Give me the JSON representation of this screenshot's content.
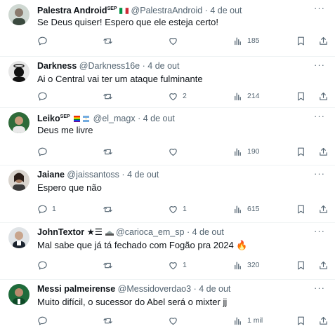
{
  "feed": {
    "more_label": "···",
    "tweets": [
      {
        "name": "Palestra Android",
        "name_sup": "SEP",
        "handle": "@PalestraAndroid",
        "separator": "·",
        "date": "4 de out",
        "text": "Se Deus quiser! Espero que ele esteja certo!",
        "replies": "",
        "retweets": "",
        "likes": "",
        "views": "185",
        "flags": [
          "italy-flag-icon"
        ]
      },
      {
        "name": "Darkness",
        "name_sup": "",
        "handle": "@Darkness16e",
        "separator": "·",
        "date": "4 de out",
        "text": "Ai o Central vai ter um ataque fulminante",
        "replies": "",
        "retweets": "",
        "likes": "2",
        "views": "214",
        "flags": []
      },
      {
        "name": "Leiko",
        "name_sup": "SEP",
        "handle": "@el_magx",
        "separator": "·",
        "date": "4 de out",
        "text": "Deus me livre",
        "replies": "",
        "retweets": "",
        "likes": "",
        "views": "190",
        "flags": [
          "rainbow-flag-icon",
          "argentina-flag-icon"
        ]
      },
      {
        "name": "Jaiane",
        "name_sup": "",
        "handle": "@jaissantoss",
        "separator": "·",
        "date": "4 de out",
        "text": "Espero que não",
        "replies": "1",
        "retweets": "",
        "likes": "1",
        "views": "615",
        "flags": []
      },
      {
        "name": "JohnTextor ★☰",
        "name_sup": "",
        "handle": "@carioca_em_sp",
        "separator": "·",
        "date": "4 de out",
        "text": "Mal sabe que já tá fechado com Fogão pra 2024 🔥",
        "replies": "",
        "retweets": "",
        "likes": "1",
        "views": "320",
        "flags": [
          "stadium-icon"
        ]
      },
      {
        "name": "Messi palmeirense",
        "name_sup": "",
        "handle": "@Messidoverdao3",
        "separator": "·",
        "date": "4 de out",
        "text": "Muito difícil, o sucessor do Abel será o mixter jj",
        "replies": "",
        "retweets": "",
        "likes": "",
        "views": "1 mil",
        "flags": []
      }
    ]
  },
  "colors": {
    "text": "#0f1419",
    "secondary": "#536471",
    "divider": "#eff3f4"
  }
}
